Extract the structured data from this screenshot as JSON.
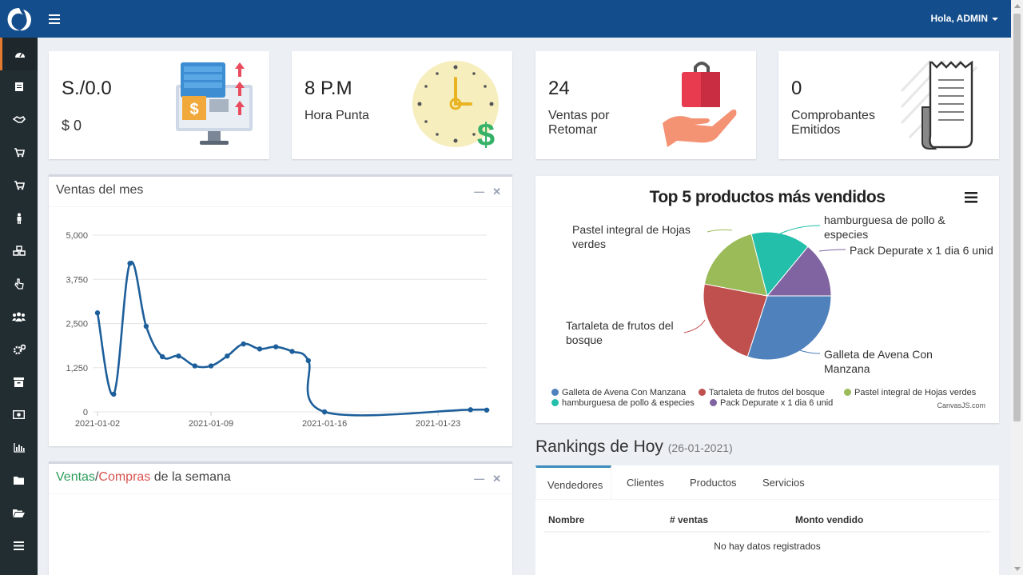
{
  "header": {
    "user_label": "Hola, ADMIN"
  },
  "sidebar": {
    "items": [
      {
        "icon": "dashboard-icon"
      },
      {
        "icon": "document-icon"
      },
      {
        "icon": "handshake-icon"
      },
      {
        "icon": "cart-icon"
      },
      {
        "icon": "cart-plus-icon"
      },
      {
        "icon": "person-icon"
      },
      {
        "icon": "cubes-icon"
      },
      {
        "icon": "hand-pointer-icon"
      },
      {
        "icon": "users-icon"
      },
      {
        "icon": "gears-icon"
      },
      {
        "icon": "archive-icon"
      },
      {
        "icon": "money-icon"
      },
      {
        "icon": "bar-chart-icon"
      },
      {
        "icon": "folder-icon"
      },
      {
        "icon": "folder-open-icon"
      },
      {
        "icon": "list-icon"
      }
    ]
  },
  "stats": [
    {
      "value": "S./0.0",
      "label": "$ 0"
    },
    {
      "value": "8 P.M",
      "label": "Hora Punta"
    },
    {
      "value": "24",
      "label": "Ventas por Retomar"
    },
    {
      "value": "0",
      "label": "Comprobantes Emitidos"
    }
  ],
  "ventas_mes": {
    "title": "Ventas del mes"
  },
  "semana": {
    "title_a": "Ventas",
    "sep": "/",
    "title_b": "Compras",
    "title_c": " de la semana"
  },
  "colors": {
    "ventas": "#2e9e5b",
    "compras": "#d9534f",
    "line": "#1d5f9b"
  },
  "chart_data": [
    {
      "type": "line",
      "title": "",
      "x": [
        "2021-01-02",
        "2021-01-03",
        "2021-01-04",
        "2021-01-05",
        "2021-01-06",
        "2021-01-07",
        "2021-01-08",
        "2021-01-09",
        "2021-01-10",
        "2021-01-11",
        "2021-01-12",
        "2021-01-13",
        "2021-01-14",
        "2021-01-15",
        "2021-01-16",
        "2021-01-25",
        "2021-01-26"
      ],
      "x_ticks": [
        "2021-01-02",
        "2021-01-09",
        "2021-01-16",
        "2021-01-23"
      ],
      "values": [
        2800,
        500,
        4200,
        2420,
        1560,
        1580,
        1300,
        1300,
        1580,
        1920,
        1780,
        1840,
        1710,
        1450,
        0,
        60,
        50
      ],
      "y_ticks": [
        "5,000",
        "3,750",
        "2,500",
        "1,250",
        "0"
      ],
      "ylim": [
        0,
        5000
      ],
      "grid": true
    },
    {
      "type": "pie",
      "title": "Top 5 productos más vendidos",
      "slices": [
        {
          "name": "Galleta de Avena Con Manzana",
          "value": 30,
          "color": "#4f81bc"
        },
        {
          "name": "Tartaleta de frutos del bosque",
          "value": 23,
          "color": "#c0504e"
        },
        {
          "name": "Pastel integral de Hojas verdes",
          "value": 18,
          "color": "#9bbb58"
        },
        {
          "name": "hamburguesa de pollo & especies",
          "value": 15,
          "color": "#23bfaa"
        },
        {
          "name": "Pack Depurate x 1 dia 6 unid",
          "value": 14,
          "color": "#8064a1"
        }
      ],
      "labels": {
        "galleta": "Galleta de Avena Con Manzana",
        "tartaleta": "Tartaleta de frutos del bosque",
        "pastel": "Pastel integral de Hojas verdes",
        "hamburguesa": "hamburguesa de pollo & especies",
        "pack": "Pack Depurate x 1 dia 6 unid"
      },
      "credit": "CanvasJS.com"
    }
  ],
  "rankings": {
    "title": "Rankings de Hoy",
    "date": "(26-01-2021)",
    "tabs": [
      "Vendedores",
      "Clientes",
      "Productos",
      "Servicios"
    ],
    "columns": [
      "Nombre",
      "# ventas",
      "Monto vendido"
    ],
    "empty": "No hay datos registrados"
  }
}
